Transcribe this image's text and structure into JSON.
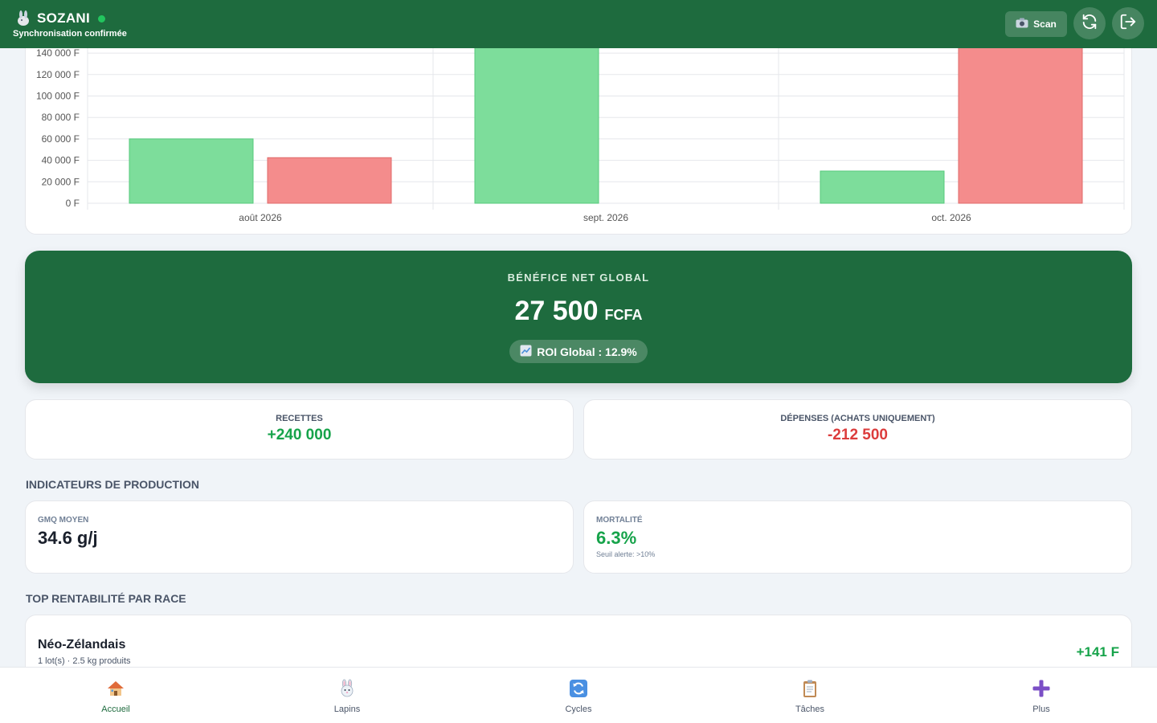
{
  "header": {
    "app_name": "SOZANI",
    "sync_status": "Synchronisation confirmée",
    "scan_label": "Scan",
    "colors": {
      "primary": "#1e6b3e",
      "online": "#22c55e"
    },
    "icons": [
      "rabbit-logo-icon",
      "camera-icon",
      "refresh-icon",
      "logout-icon"
    ]
  },
  "chart_data": {
    "type": "bar",
    "categories": [
      "août 2026",
      "sept. 2026",
      "oct. 2026"
    ],
    "series": [
      {
        "values": [
          60000,
          240000,
          30000
        ],
        "color": "#7ddd9b",
        "stroke": "#56c97b"
      },
      {
        "values": [
          42500,
          0,
          170000
        ],
        "color": "#f48c8c",
        "stroke": "#e06a6a"
      }
    ],
    "y_ticks": [
      "0 F",
      "20 000 F",
      "40 000 F",
      "60 000 F",
      "80 000 F",
      "100 000 F",
      "120 000 F",
      "140 000 F"
    ],
    "ylim": [
      0,
      140000
    ],
    "grid": true
  },
  "profit": {
    "title": "BÉNÉFICE NET GLOBAL",
    "amount": "27 500",
    "unit": "FCFA",
    "roi": "ROI Global : 12.9%"
  },
  "stats": {
    "income_label": "RECETTES",
    "income_value": "+240 000",
    "expense_label": "DÉPENSES (ACHATS UNIQUEMENT)",
    "expense_value": "-212 500",
    "colors": {
      "income": "#16a34a",
      "expense": "#dc3c3c"
    }
  },
  "production": {
    "title": "INDICATEURS DE PRODUCTION",
    "gmq_label": "GMQ MOYEN",
    "gmq_value": "34.6 g/j",
    "mortality_label": "MORTALITÉ",
    "mortality_value": "6.3%",
    "mortality_note": "Seuil alerte: >10%"
  },
  "race": {
    "title": "TOP RENTABILITÉ PAR RACE",
    "items": [
      {
        "name": "Néo-Zélandais",
        "detail": "1 lot(s) · 2.5 kg produits",
        "value": "+141 F"
      }
    ]
  },
  "nav": {
    "items": [
      {
        "label": "Accueil",
        "icon": "home-icon"
      },
      {
        "label": "Lapins",
        "icon": "rabbit-icon"
      },
      {
        "label": "Cycles",
        "icon": "cycle-icon"
      },
      {
        "label": "Tâches",
        "icon": "clipboard-icon"
      },
      {
        "label": "Plus",
        "icon": "plus-icon"
      }
    ]
  }
}
